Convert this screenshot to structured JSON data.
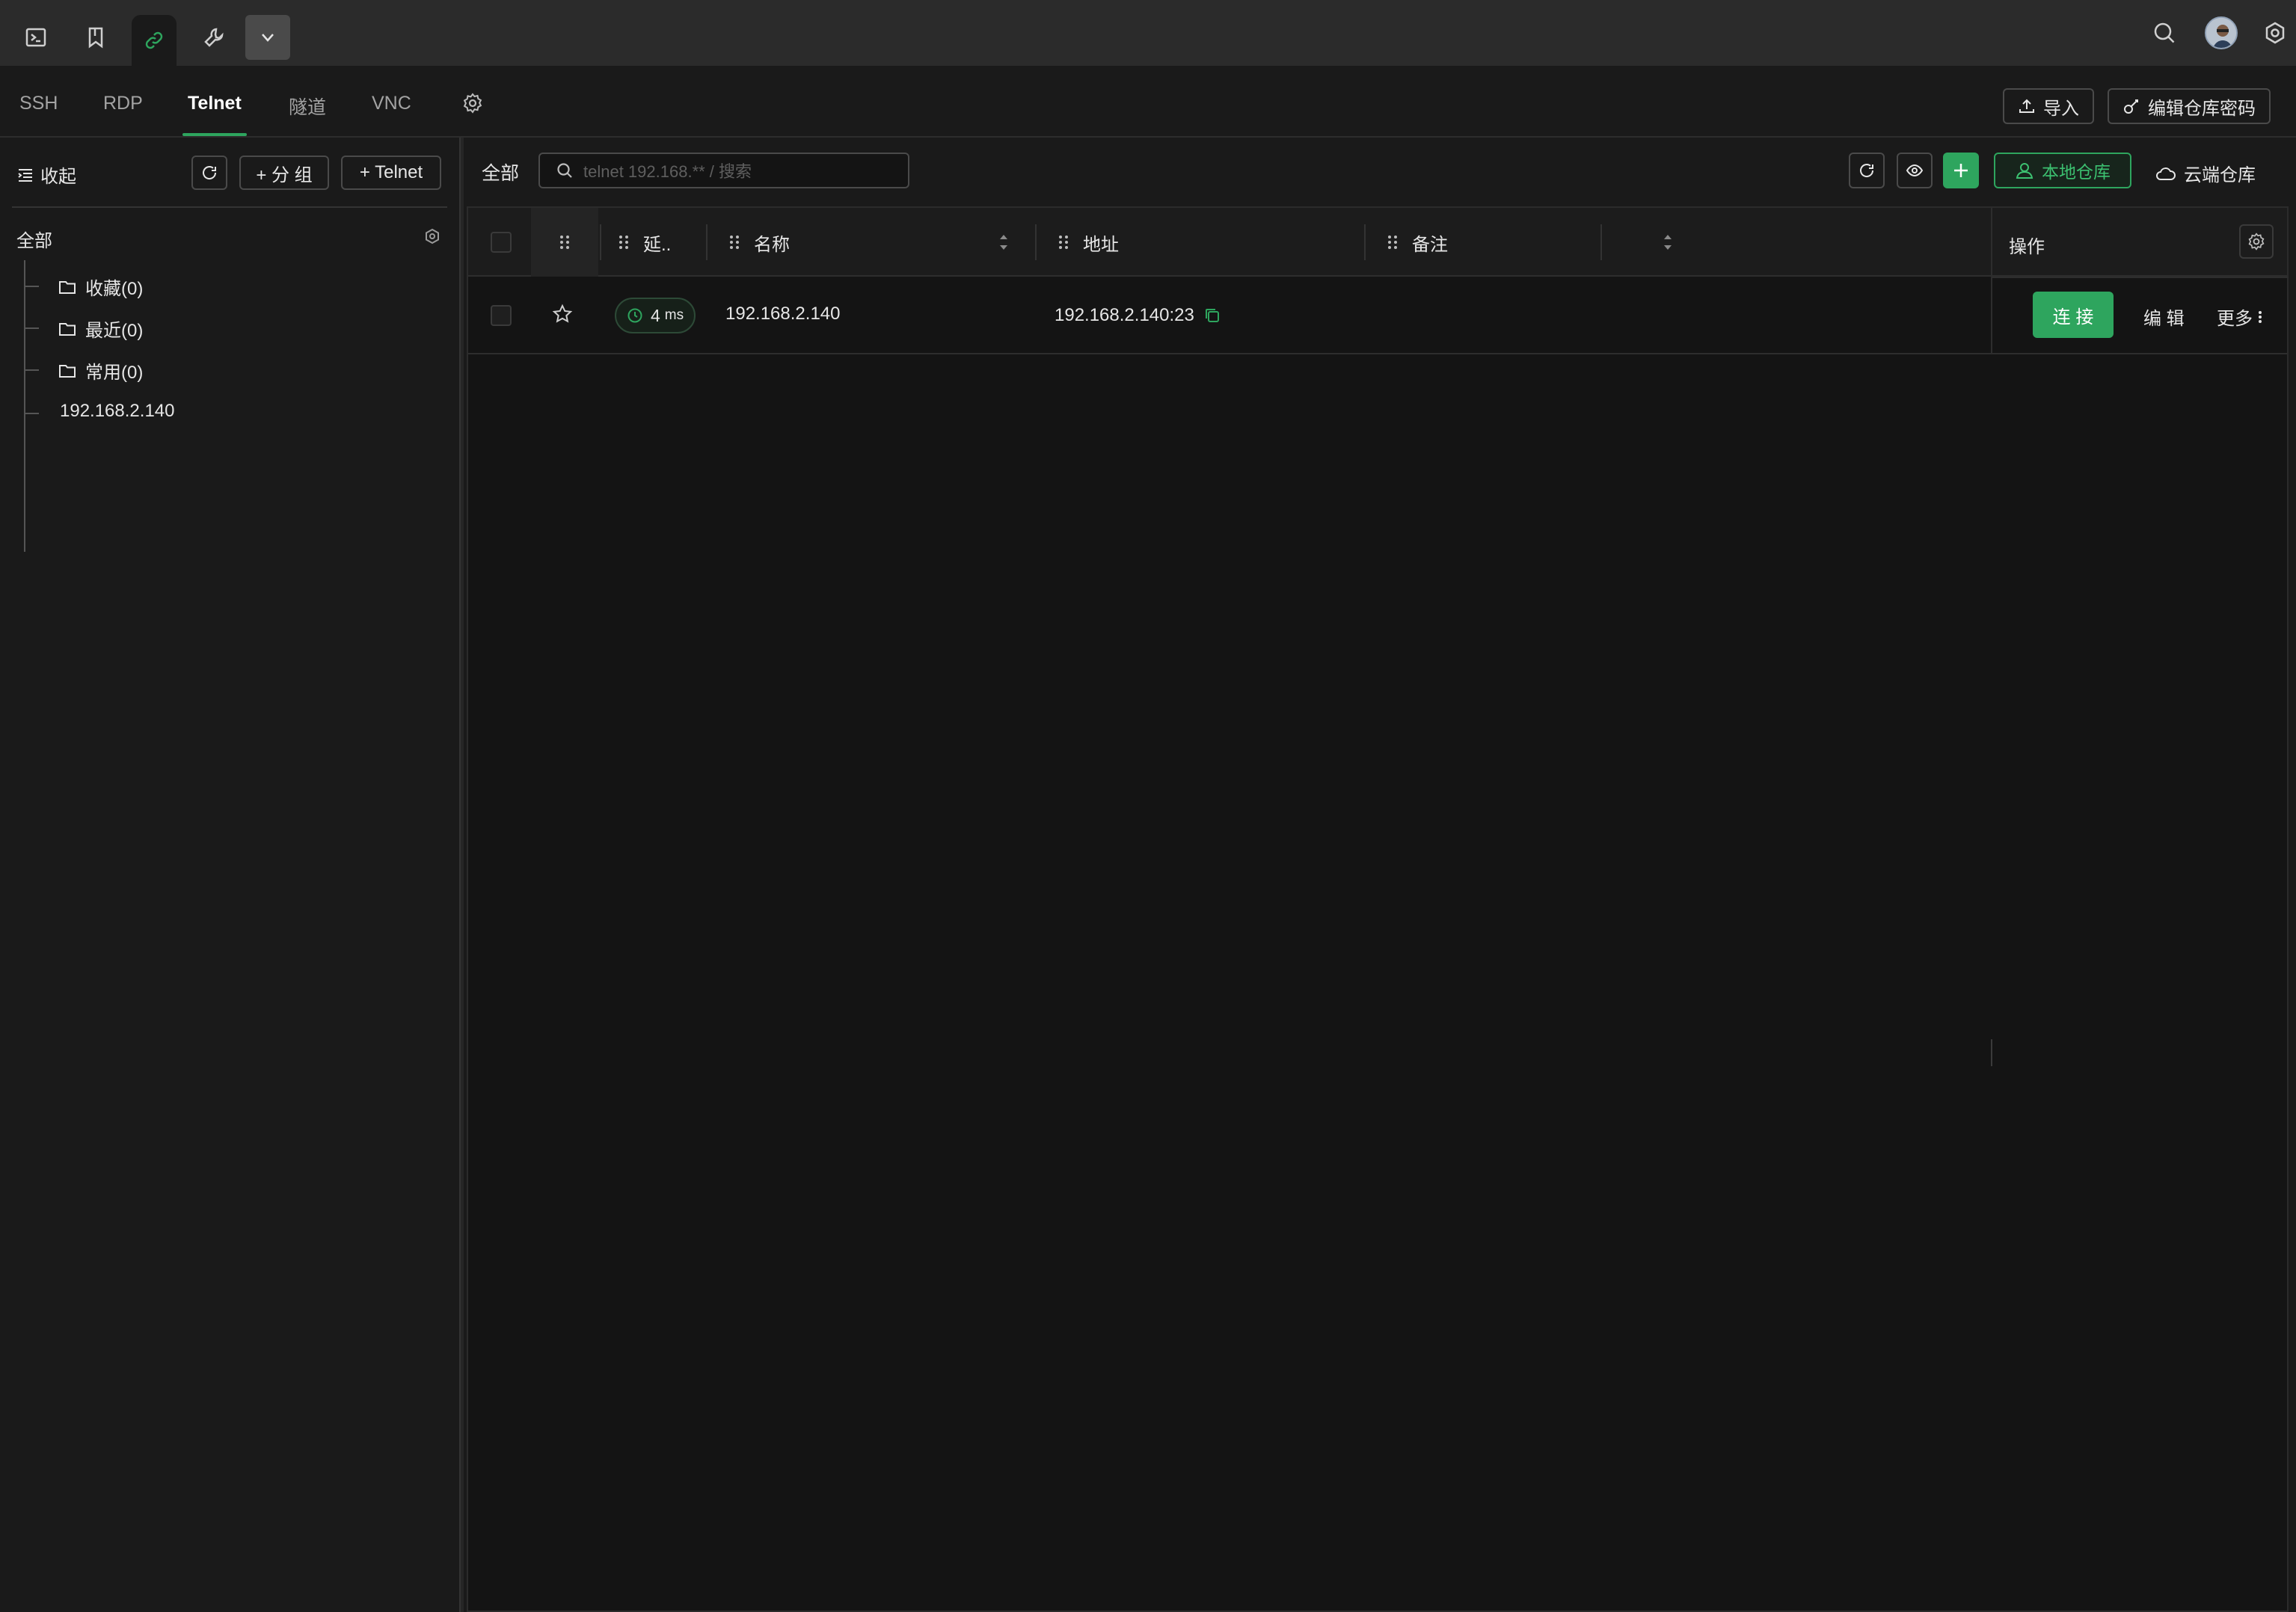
{
  "titlebar": {
    "left_icons": [
      "terminal-icon",
      "bookmark-icon",
      "link-icon",
      "wrench-icon",
      "chevron-down-icon"
    ],
    "active_index": 2,
    "right_icons": [
      "search-icon",
      "avatar",
      "settings-icon"
    ]
  },
  "protocol_tabs": [
    {
      "label": "SSH",
      "active": false
    },
    {
      "label": "RDP",
      "active": false
    },
    {
      "label": "Telnet",
      "active": true
    },
    {
      "label": "隧道",
      "active": false
    },
    {
      "label": "VNC",
      "active": false
    }
  ],
  "toolbar": {
    "import_label": "导入",
    "edit_vault_password_label": "编辑仓库密码"
  },
  "sidebar": {
    "collapse_label": "收起",
    "add_group_label": "+ 分 组",
    "add_telnet_label": "+ Telnet",
    "root_label": "全部",
    "tree": [
      {
        "type": "folder",
        "label": "收藏(0)"
      },
      {
        "type": "folder",
        "label": "最近(0)"
      },
      {
        "type": "folder",
        "label": "常用(0)"
      },
      {
        "type": "host",
        "label": "192.168.2.140"
      }
    ]
  },
  "main": {
    "scope_label": "全部",
    "search_placeholder": "telnet 192.168.** / 搜索",
    "local_vault_label": "本地仓库",
    "cloud_vault_label": "云端仓库"
  },
  "table": {
    "columns": {
      "latency": "延..",
      "name": "名称",
      "address": "地址",
      "note": "备注",
      "actions": "操作"
    },
    "rows": [
      {
        "latency": "4",
        "latency_unit": "ms",
        "name": "192.168.2.140",
        "address": "192.168.2.140:23",
        "note": "",
        "connect_label": "连 接",
        "edit_label": "编 辑",
        "more_label": "更多"
      }
    ]
  },
  "colors": {
    "accent": "#2ea55e",
    "background": "#141414",
    "panel": "#1a1a1a",
    "titlebar": "#2b2b2b"
  }
}
